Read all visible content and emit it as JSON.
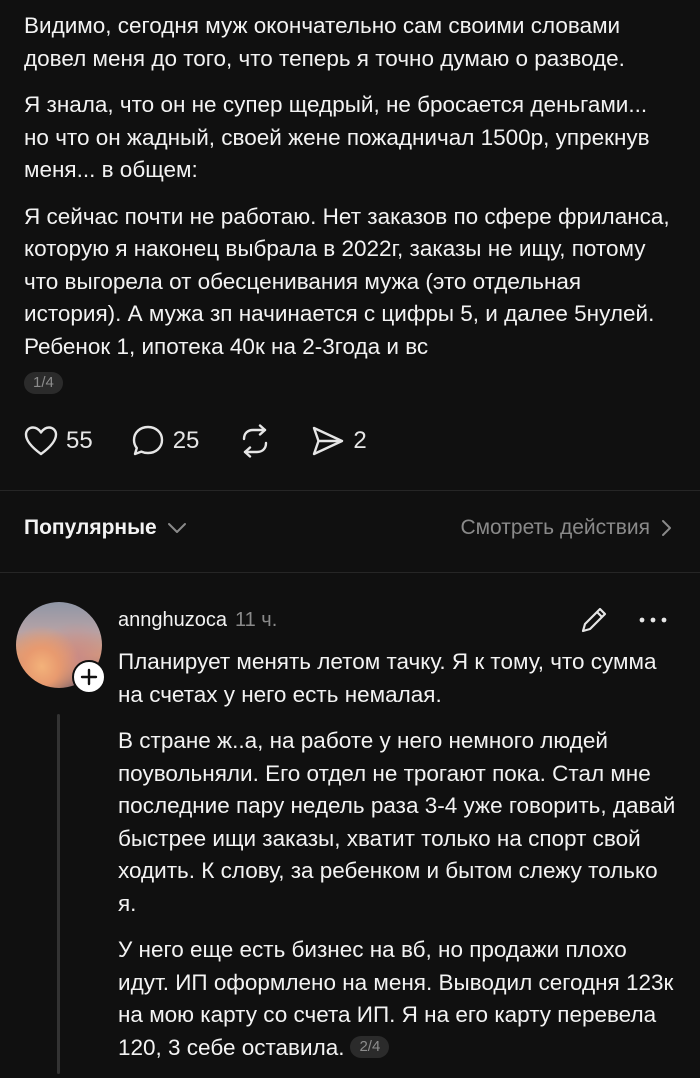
{
  "post": {
    "paragraphs": [
      "Видимо, сегодня муж окончательно сам своими словами довел меня до того, что теперь я точно думаю о разводе.",
      "Я знала, что он не супер щедрый, не бросается деньгами... но что он жадный, своей жене пожадничал 1500р, упрекнув меня... в общем:",
      "Я сейчас почти не работаю. Нет заказов по сфере фриланса, которую я наконец выбрала в 2022г, заказы не ищу, потому что выгорела от обесценивания мужа (это отдельная история). А мужа зп начинается с цифры 5, и далее 5нулей. Ребенок 1, ипотека 40к на 2-3года и вс"
    ],
    "page_indicator": "1/4",
    "likes": "55",
    "comments": "25",
    "shares": "2"
  },
  "sort": {
    "label": "Популярные",
    "view_activity": "Смотреть действия"
  },
  "comment": {
    "username": "annghuzoca",
    "time": "11 ч.",
    "paragraphs": [
      "Планирует менять летом тачку. Я к тому, что сумма на счетах у него есть немалая.",
      "В стране ж..а, на работе у него немного людей поувольняли. Его отдел не трогают пока. Стал мне последние пару недель раза 3-4 уже говорить, давай быстрее ищи заказы, хватит только на спорт свой ходить. К слову, за ребенком и бытом слежу только я.",
      "У него еще есть бизнес на вб, но продажи плохо идут. ИП оформлено на меня. Выводил сегодня 123к на мою карту со счета ИП. Я на его карту перевела 120, 3 себе оставила."
    ],
    "page_indicator": "2/4"
  },
  "icons": {
    "like": "heart-icon",
    "comment": "speech-bubble-icon",
    "repost": "repost-icon",
    "share": "send-icon",
    "sort": "chevron-down-icon",
    "view": "chevron-right-icon",
    "edit": "pencil-icon",
    "more": "more-dots-icon",
    "follow": "plus-icon"
  },
  "colors": {
    "background": "#101010",
    "text": "#f3f3f3",
    "muted": "#8a8a8a"
  }
}
